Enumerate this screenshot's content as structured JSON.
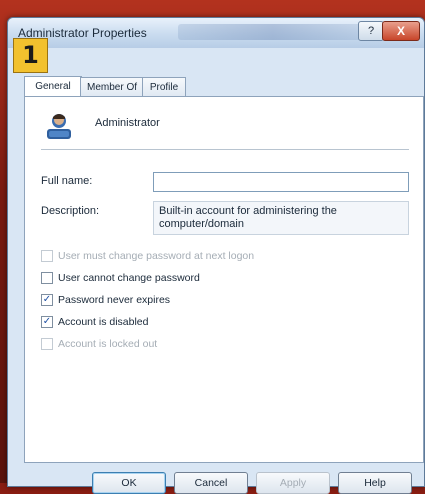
{
  "window": {
    "title": "Administrator Properties",
    "help_label": "?",
    "close_label": "X"
  },
  "step_badge": "1",
  "tabs": [
    {
      "label": "General",
      "active": true
    },
    {
      "label": "Member Of",
      "active": false
    },
    {
      "label": "Profile",
      "active": false
    }
  ],
  "user": {
    "name": "Administrator",
    "icon": "user-icon"
  },
  "fields": {
    "full_name_label": "Full name:",
    "full_name_value": "",
    "description_label": "Description:",
    "description_value": "Built-in account for administering the computer/domain"
  },
  "checkboxes": [
    {
      "label": "User must change password at next logon",
      "checked": false,
      "enabled": false
    },
    {
      "label": "User cannot change password",
      "checked": false,
      "enabled": true
    },
    {
      "label": "Password never expires",
      "checked": true,
      "enabled": true
    },
    {
      "label": "Account is disabled",
      "checked": true,
      "enabled": true
    },
    {
      "label": "Account is locked out",
      "checked": false,
      "enabled": false
    }
  ],
  "buttons": {
    "ok": "OK",
    "cancel": "Cancel",
    "apply": "Apply",
    "help": "Help"
  },
  "colors": {
    "accent_badge": "#f2c12e",
    "check_mark": "#1e4fa3",
    "background": "#8a1d12"
  }
}
